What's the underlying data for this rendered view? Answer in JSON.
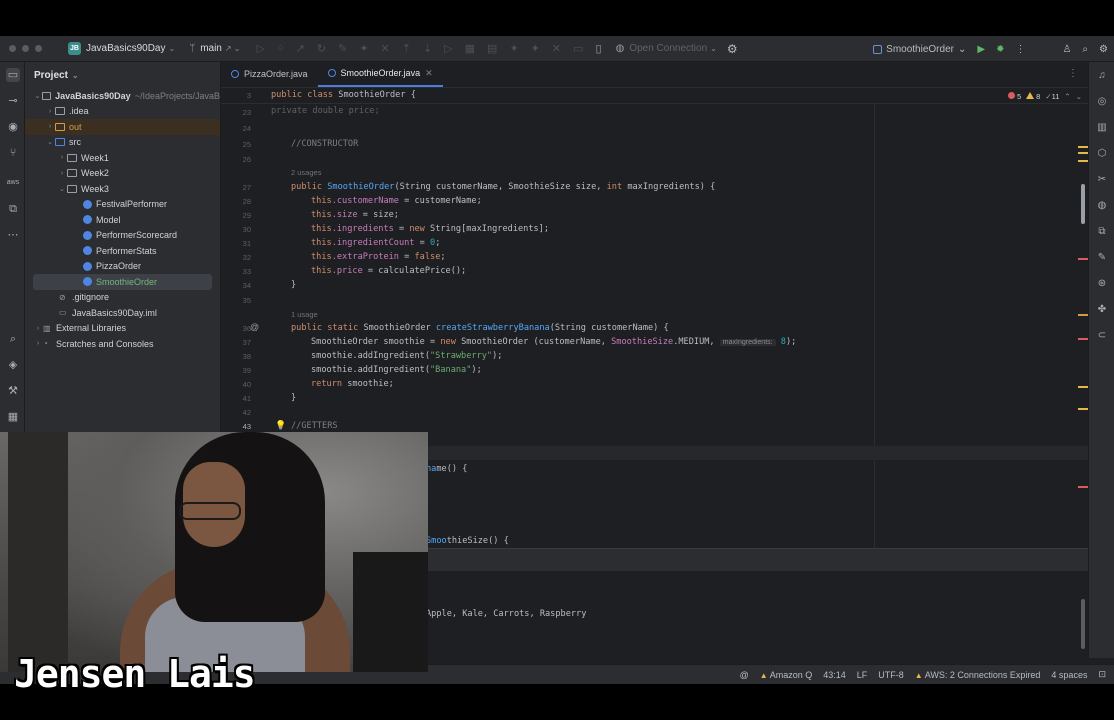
{
  "titlebar": {
    "project_badge": "JB",
    "project_name": "JavaBasics90Day",
    "branch": "main",
    "connection": "Open Connection",
    "run_config": "SmoothieOrder"
  },
  "project_panel": {
    "title": "Project",
    "root": {
      "name": "JavaBasics90Day",
      "path": "~/IdeaProjects/JavaB"
    },
    "items": [
      {
        "label": ".idea"
      },
      {
        "label": "out"
      },
      {
        "label": "src"
      },
      {
        "label": "Week1"
      },
      {
        "label": "Week2"
      },
      {
        "label": "Week3"
      },
      {
        "label": "FestivalPerformer"
      },
      {
        "label": "Model"
      },
      {
        "label": "PerformerScorecard"
      },
      {
        "label": "PerformerStats"
      },
      {
        "label": "PizzaOrder"
      },
      {
        "label": "SmoothieOrder"
      },
      {
        "label": ".gitignore"
      },
      {
        "label": "JavaBasics90Day.iml"
      },
      {
        "label": "External Libraries"
      },
      {
        "label": "Scratches and Consoles"
      }
    ]
  },
  "tabs": [
    {
      "label": "PizzaOrder.java"
    },
    {
      "label": "SmoothieOrder.java"
    }
  ],
  "inspection": {
    "errors": "5",
    "warnings": "8",
    "hints": "11"
  },
  "sticky_line": {
    "num": "3",
    "code_kw": "public class ",
    "code_name": "SmoothieOrder {"
  },
  "code": {
    "ln23": "23",
    "l23": "private double price;",
    "ln24": "24",
    "ln25": "25",
    "l25": "//CONSTRUCTOR",
    "ln26": "26",
    "usage1": "2 usages",
    "ln27": "27",
    "l27a": "public ",
    "l27b": "SmoothieOrder",
    "l27c": "(String customerName, SmoothieSize size, ",
    "l27d": "int",
    "l27e": " maxIngredients) {",
    "ln28": "28",
    "l28a": "this",
    "l28b": ".customerName",
    "l28c": " = customerName;",
    "ln29": "29",
    "l29a": "this",
    "l29b": ".size",
    "l29c": " = size;",
    "ln30": "30",
    "l30a": "this",
    "l30b": ".ingredients",
    "l30c": " = ",
    "l30d": "new",
    "l30e": " String[maxIngredients];",
    "ln31": "31",
    "l31a": "this",
    "l31b": ".ingredientCount",
    "l31c": " = ",
    "l31d": "0",
    "l31e": ";",
    "ln32": "32",
    "l32a": "this",
    "l32b": ".extraProtein",
    "l32c": " = ",
    "l32d": "false",
    "l32e": ";",
    "ln33": "33",
    "l33a": "this",
    "l33b": ".price",
    "l33c": " = calculatePrice();",
    "ln34": "34",
    "l34": "}",
    "ln35": "35",
    "usage2": "1 usage",
    "ln36": "36",
    "l36a": "public static ",
    "l36b": "SmoothieOrder ",
    "l36c": "createStrawberryBanana",
    "l36d": "(String customerName) {",
    "ln37": "37",
    "l37a": "SmoothieOrder smoothie = ",
    "l37b": "new",
    "l37c": " SmoothieOrder (customerName, ",
    "l37d": "SmoothieSize",
    "l37e": ".MEDIUM, ",
    "l37hint": "maxIngredients:",
    "l37f": "8",
    "l37g": ");",
    "ln38": "38",
    "l38a": "smoothie.addIngredient(",
    "l38b": "\"Strawberry\"",
    "l38c": ");",
    "ln39": "39",
    "l39a": "smoothie.addIngredient(",
    "l39b": "\"Banana\"",
    "l39c": ");",
    "ln40": "40",
    "l40a": "return",
    "l40b": " smoothie;",
    "ln41": "41",
    "l41": "}",
    "ln42": "42",
    "ln43": "43",
    "l43": "//GETTERS",
    "frag1": "me() {",
    "frag2": "thieSize() {"
  },
  "console_output": "Apple, Kale, Carrots, Raspberry",
  "status": {
    "at": "@",
    "amazon_q": "Amazon Q",
    "position": "43:14",
    "line_sep": "LF",
    "encoding": "UTF-8",
    "aws": "AWS: 2 Connections Expired",
    "indent": "4 spaces"
  },
  "caption": "Jensen Lais"
}
